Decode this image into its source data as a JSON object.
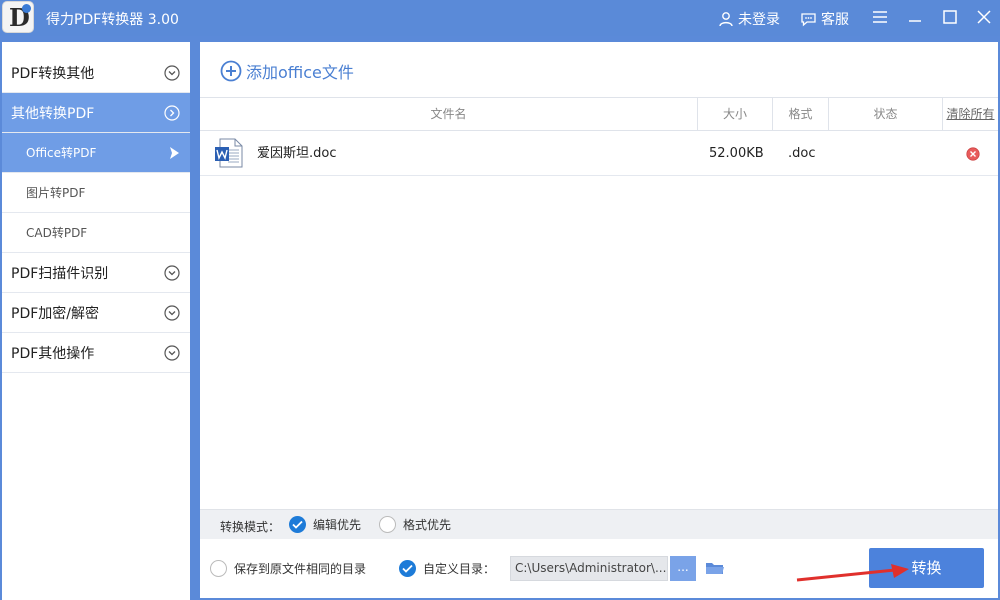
{
  "app": {
    "title": "得力PDF转换器 3.00",
    "logo_letter": "D",
    "login_label": "未登录",
    "service_label": "客服"
  },
  "sidebar": {
    "items": [
      {
        "label": "PDF转换其他",
        "state": "collapsed"
      },
      {
        "label": "其他转换PDF",
        "state": "expanded"
      },
      {
        "label": "Office转PDF",
        "state": "selected"
      },
      {
        "label": "图片转PDF"
      },
      {
        "label": "CAD转PDF"
      },
      {
        "label": "PDF扫描件识别",
        "state": "collapsed"
      },
      {
        "label": "PDF加密/解密",
        "state": "collapsed"
      },
      {
        "label": "PDF其他操作",
        "state": "collapsed"
      }
    ]
  },
  "toolbar": {
    "add_label": "添加office文件"
  },
  "table": {
    "headers": {
      "name": "文件名",
      "size": "大小",
      "format": "格式",
      "status": "状态",
      "clear": "清除所有"
    },
    "rows": [
      {
        "name": "爱因斯坦.doc",
        "size": "52.00KB",
        "format": ".doc",
        "status": "",
        "icon": "word-doc-icon"
      }
    ]
  },
  "options": {
    "mode_label": "转换模式：",
    "mode_edit": "编辑优先",
    "mode_edit_checked": true,
    "mode_format": "格式优先",
    "mode_format_checked": false,
    "save_same_dir": "保存到原文件相同的目录",
    "save_same_dir_checked": false,
    "custom_dir": "自定义目录：",
    "custom_dir_checked": true,
    "path_value": "C:\\Users\\Administrator\\...",
    "browse_label": "..."
  },
  "actions": {
    "convert_label": "转换"
  },
  "colors": {
    "titlebar": "#5a8ad8",
    "accent": "#4c82dc",
    "sidebar_active": "#6f9de6",
    "check": "#1d7bd8"
  }
}
